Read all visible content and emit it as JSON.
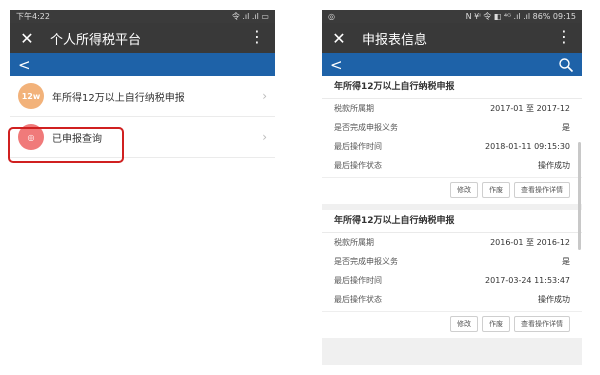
{
  "left": {
    "status": {
      "time": "下午4:22",
      "icons": "令 .ıl .ıl ▭"
    },
    "title": "个人所得税平台",
    "back_glyph": "<",
    "items": [
      {
        "avatar": "12w",
        "avatar_color": "#f2b27a",
        "label": "年所得12万以上自行纳税申报"
      },
      {
        "avatar": "◎",
        "avatar_color": "#f07a7a",
        "label": "已申报查询"
      }
    ]
  },
  "right": {
    "status": {
      "left": "◎",
      "right": "N ¥ᴵ 令 ◧ ⁴ᴳ .ıl .ıl 86% 09:15"
    },
    "title": "申报表信息",
    "back_glyph": "<",
    "records": [
      {
        "title": "年所得12万以上自行纳税申报",
        "rows": [
          {
            "label": "税款所属期",
            "value": "2017-01 至 2017-12"
          },
          {
            "label": "是否完成申报义务",
            "value": "是"
          },
          {
            "label": "最后操作时间",
            "value": "2018-01-11 09:15:30"
          },
          {
            "label": "最后操作状态",
            "value": "操作成功"
          }
        ],
        "buttons": [
          "修改",
          "作废",
          "查看操作详情"
        ]
      },
      {
        "title": "年所得12万以上自行纳税申报",
        "rows": [
          {
            "label": "税款所属期",
            "value": "2016-01 至 2016-12"
          },
          {
            "label": "是否完成申报义务",
            "value": "是"
          },
          {
            "label": "最后操作时间",
            "value": "2017-03-24 11:53:47"
          },
          {
            "label": "最后操作状态",
            "value": "操作成功"
          }
        ],
        "buttons": [
          "修改",
          "作废",
          "查看操作详情"
        ]
      }
    ]
  },
  "colors": {
    "title_bar": "#393939",
    "nav_bar": "#1e62a8",
    "highlight": "#d02020"
  }
}
